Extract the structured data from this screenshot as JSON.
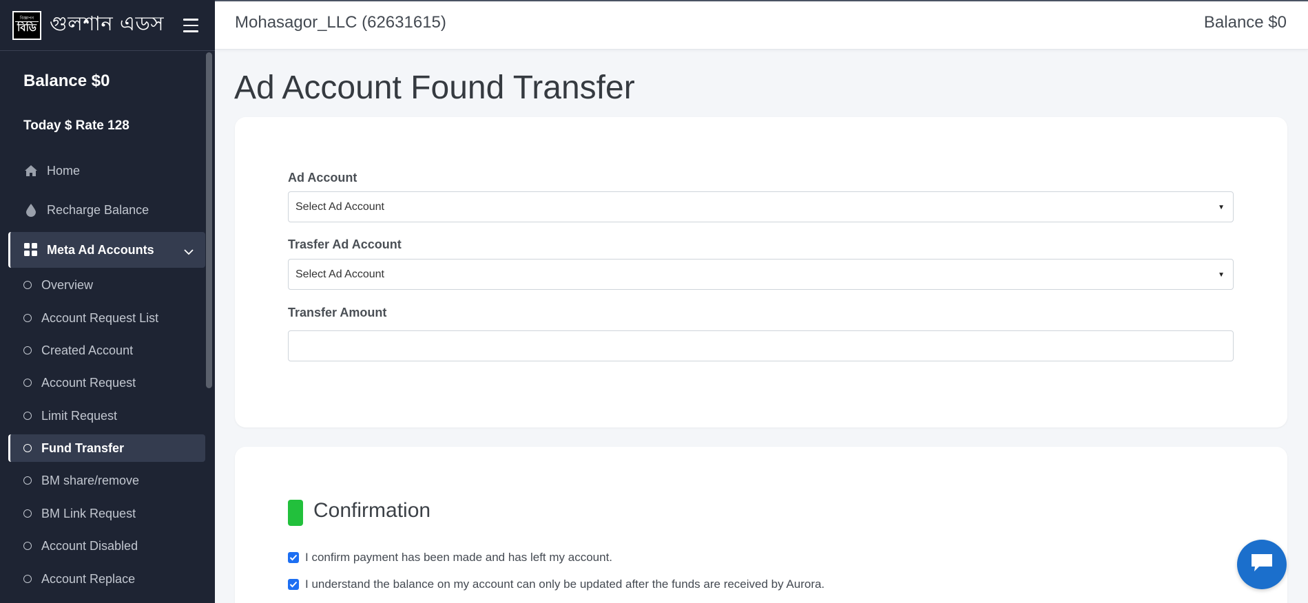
{
  "sidebar": {
    "brand_logo_top": "বিজ্ঞাপন",
    "brand_logo_bottom": "বিডি",
    "brand_name": "গুলশান এডস",
    "balance": "Balance $0",
    "rate": "Today $ Rate 128",
    "nav": {
      "home": "Home",
      "recharge": "Recharge Balance",
      "meta": "Meta Ad Accounts"
    },
    "sub_items": [
      "Overview",
      "Account Request List",
      "Created Account",
      "Account Request",
      "Limit Request",
      "Fund Transfer",
      "BM share/remove",
      "BM Link Request",
      "Account Disabled",
      "Account Replace"
    ]
  },
  "topbar": {
    "account": "Mohasagor_LLC (62631615)",
    "balance": "Balance $0"
  },
  "page": {
    "title": "Ad Account Found Transfer"
  },
  "form": {
    "ad_account_label": "Ad Account",
    "ad_account_value": "Select Ad Account",
    "transfer_account_label": "Trasfer Ad Account",
    "transfer_account_value": "Select Ad Account",
    "amount_label": "Transfer Amount",
    "amount_value": ""
  },
  "confirmation": {
    "title": "Confirmation",
    "check1": "I confirm payment has been made and has left my account.",
    "check2": "I understand the balance on my account can only be updated after the funds are received by Aurora."
  },
  "colors": {
    "sidebar_bg": "#1e2433",
    "accent_green": "#22c03c",
    "checkbox_blue": "#1d6ff2",
    "chat_blue": "#1b6fcc"
  }
}
